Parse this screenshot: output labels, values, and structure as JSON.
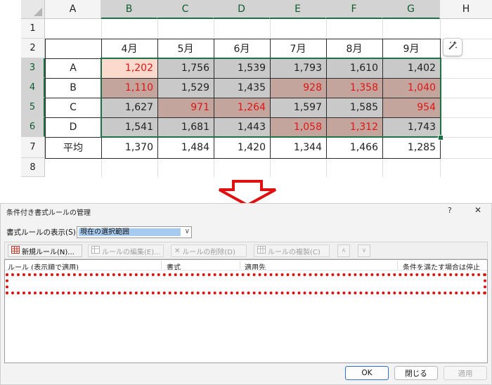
{
  "sheet": {
    "columns": [
      "A",
      "B",
      "C",
      "D",
      "E",
      "F",
      "G",
      "H"
    ],
    "rows": [
      "1",
      "2",
      "3",
      "4",
      "5",
      "6",
      "7",
      "8"
    ],
    "months": [
      "4月",
      "5月",
      "6月",
      "7月",
      "8月",
      "9月"
    ],
    "data_rows": [
      {
        "label": "A",
        "values": [
          "1,202",
          "1,756",
          "1,539",
          "1,793",
          "1,610",
          "1,402"
        ]
      },
      {
        "label": "B",
        "values": [
          "1,110",
          "1,529",
          "1,435",
          "928",
          "1,358",
          "1,040"
        ]
      },
      {
        "label": "C",
        "values": [
          "1,627",
          "971",
          "1,264",
          "1,597",
          "1,585",
          "954"
        ]
      },
      {
        "label": "D",
        "values": [
          "1,541",
          "1,681",
          "1,443",
          "1,058",
          "1,312",
          "1,743"
        ]
      }
    ],
    "average": {
      "label": "平均",
      "values": [
        "1,370",
        "1,484",
        "1,420",
        "1,344",
        "1,466",
        "1,285"
      ]
    },
    "colors": {
      "highlight_fill": "#c4a59d",
      "highlight_text": "#e01414",
      "gray_fill": "#c9c9c9",
      "active_fill": "#fbd9cc",
      "selection": "#1e7145"
    },
    "quick_analysis_icon": "sparkle-wand-icon"
  },
  "dialog": {
    "title": "条件付き書式ルールの管理",
    "help": "?",
    "close": "✕",
    "show_rules_label": "書式ルールの表示(S):",
    "show_rules_value": "現在の選択範囲",
    "toolbar": {
      "new_rule": "新規ルール(N)...",
      "edit_rule": "ルールの編集(E)...",
      "delete_rule": "ルールの削除(D)",
      "duplicate_rule": "ルールの複製(C)",
      "move_up": "∧",
      "move_down": "∨"
    },
    "columns": [
      "ルール (表示順で適用)",
      "書式",
      "適用先",
      "条件を満たす場合は停止"
    ],
    "buttons": {
      "ok": "OK",
      "close": "閉じる",
      "apply": "適用"
    },
    "highlight_color": "#e01010"
  },
  "arrow_color": "#e01010"
}
